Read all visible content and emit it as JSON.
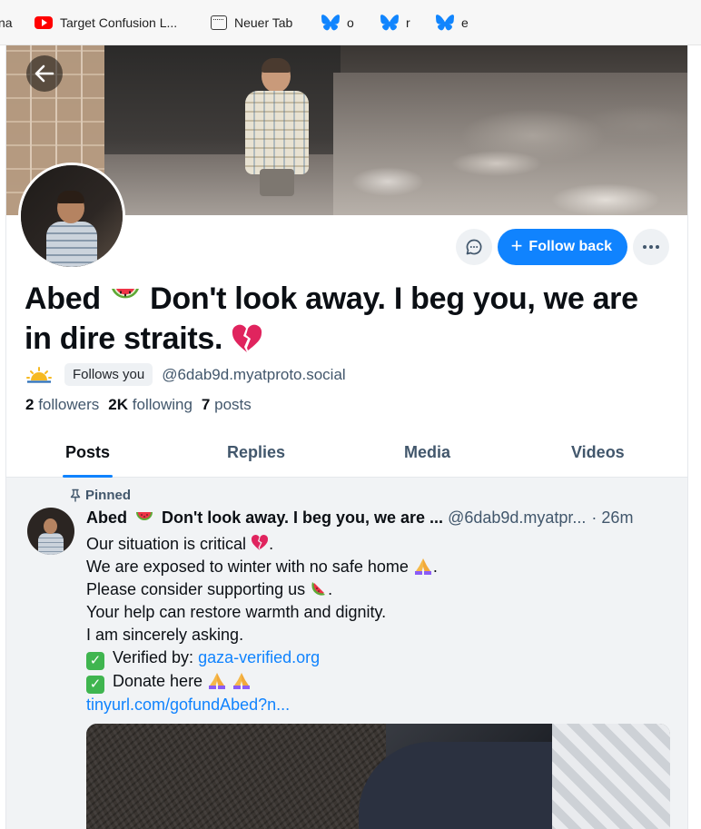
{
  "bookmarks": [
    {
      "label": "na",
      "icon": "none"
    },
    {
      "label": "Target Confusion L...",
      "icon": "youtube-icon"
    },
    {
      "label": "Neuer Tab",
      "icon": "tab-icon"
    },
    {
      "label": "o",
      "icon": "bluesky-butterfly-icon"
    },
    {
      "label": "r",
      "icon": "bluesky-butterfly-icon"
    },
    {
      "label": "e",
      "icon": "bluesky-butterfly-icon"
    }
  ],
  "profile": {
    "name_part1": "Abed",
    "name_part2": "Don't look away. I beg you, we are in dire straits.",
    "follows_you": "Follows you",
    "handle": "@6dab9d.myatproto.social",
    "followers_count": "2",
    "followers_label": "followers",
    "following_count": "2K",
    "following_label": "following",
    "posts_count": "7",
    "posts_label": "posts"
  },
  "actions": {
    "follow_back": "Follow back",
    "plus": "+"
  },
  "tabs": [
    {
      "label": "Posts",
      "active": true
    },
    {
      "label": "Replies",
      "active": false
    },
    {
      "label": "Media",
      "active": false
    },
    {
      "label": "Videos",
      "active": false
    }
  ],
  "post": {
    "pinned": "Pinned",
    "author_name": "Abed",
    "author_name_rest": "Don't look away. I beg you, we are ...",
    "handle": "@6dab9d.myatpr...",
    "time": "· 26m",
    "line1": "Our situation is critical",
    "line2": "We are exposed to winter with no safe home",
    "line3": "Please consider supporting us",
    "line4": "Your help can restore warmth and dignity.",
    "line5": "I am sincerely asking.",
    "line6_label": "Verified by:",
    "line6_link": "gaza-verified.org",
    "line7": "Donate here",
    "line8_link": "tinyurl.com/gofundAbed?n...",
    "period": "."
  },
  "colors": {
    "accent": "#1083fe",
    "muted_text": "#42576c"
  }
}
